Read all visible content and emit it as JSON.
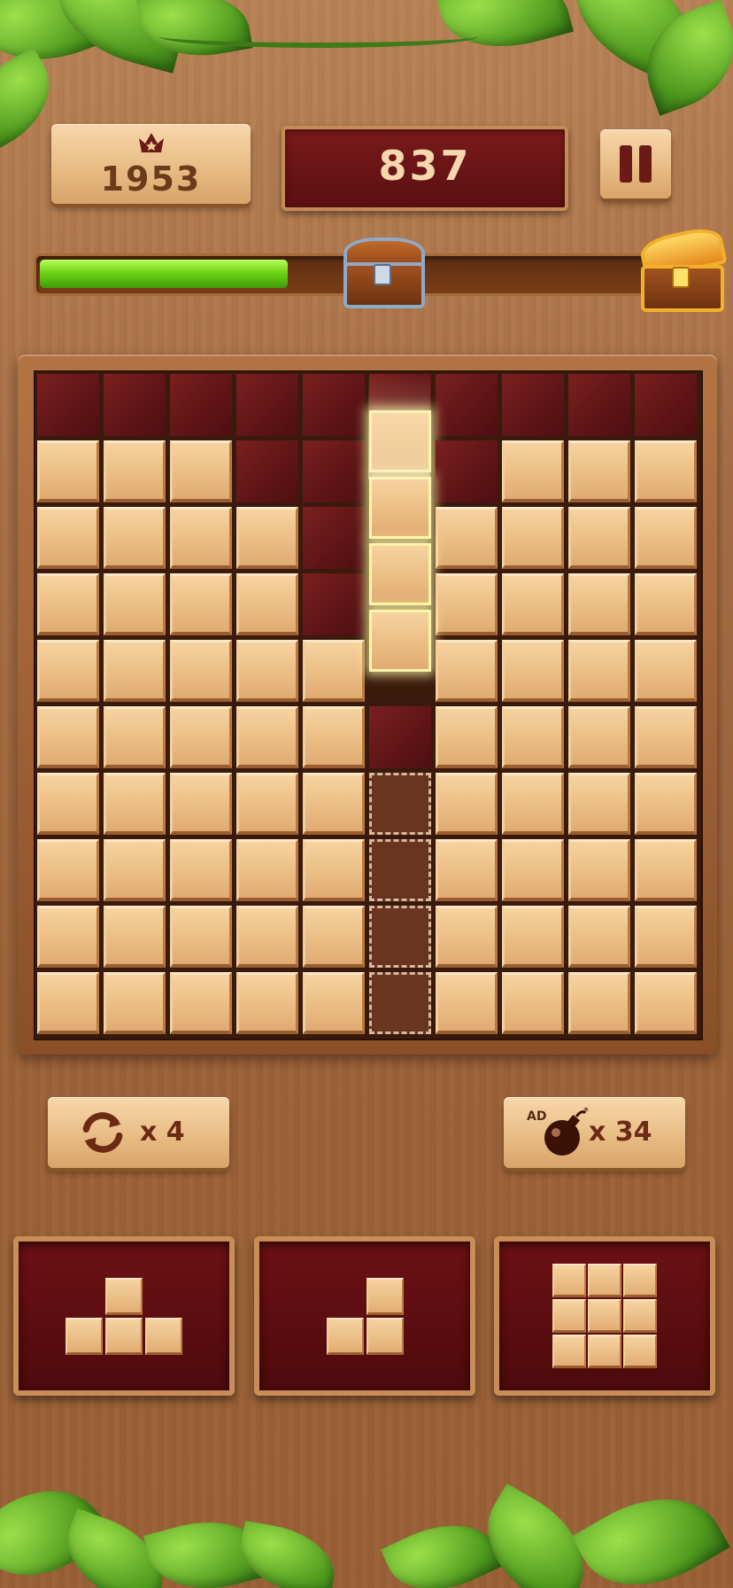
{
  "header": {
    "best_score": "1953",
    "current_score": "837",
    "crown_icon": "crown-star-icon",
    "pause_icon": "pause-icon"
  },
  "progress": {
    "fill_fraction": 0.41,
    "milestone_icon": "locked-chest-icon",
    "goal_icon": "open-gold-chest-icon"
  },
  "board": {
    "size": 10,
    "rows": [
      "..........",
      "###..#.###",
      "####.#####",
      "####.#####",
      "#####.####",
      "#####.####",
      "#####.####",
      "#####.####",
      "#####.####",
      "#####.####"
    ],
    "dragging_cells": [
      [
        1,
        5
      ],
      [
        2,
        5
      ],
      [
        3,
        5
      ],
      [
        4,
        5
      ]
    ],
    "target_cells": [
      [
        6,
        5
      ],
      [
        7,
        5
      ],
      [
        8,
        5
      ],
      [
        9,
        5
      ]
    ],
    "notes": "# = filled wood block, . = empty slot"
  },
  "powerups": {
    "rotate": {
      "icon": "rotate-arrows-icon",
      "count_label": "x 4"
    },
    "bomb": {
      "icon": "bomb-icon",
      "ad_label": "AD",
      "count_label": "x 34"
    }
  },
  "trays": [
    {
      "piece": "t-tetromino",
      "cells": [
        [
          0,
          1
        ],
        [
          1,
          0
        ],
        [
          1,
          1
        ],
        [
          1,
          2
        ]
      ]
    },
    {
      "piece": "l-tromino",
      "cells": [
        [
          0,
          1
        ],
        [
          1,
          0
        ],
        [
          1,
          1
        ]
      ]
    },
    {
      "piece": "3x3-square",
      "cells": [
        [
          0,
          0
        ],
        [
          0,
          1
        ],
        [
          0,
          2
        ],
        [
          1,
          0
        ],
        [
          1,
          1
        ],
        [
          1,
          2
        ],
        [
          2,
          0
        ],
        [
          2,
          1
        ],
        [
          2,
          2
        ]
      ]
    }
  ],
  "colors": {
    "wood_light": "#eec38b",
    "empty_cell": "#5e1416",
    "progress_green": "#6fd318",
    "score_panel": "#5a0f12"
  }
}
